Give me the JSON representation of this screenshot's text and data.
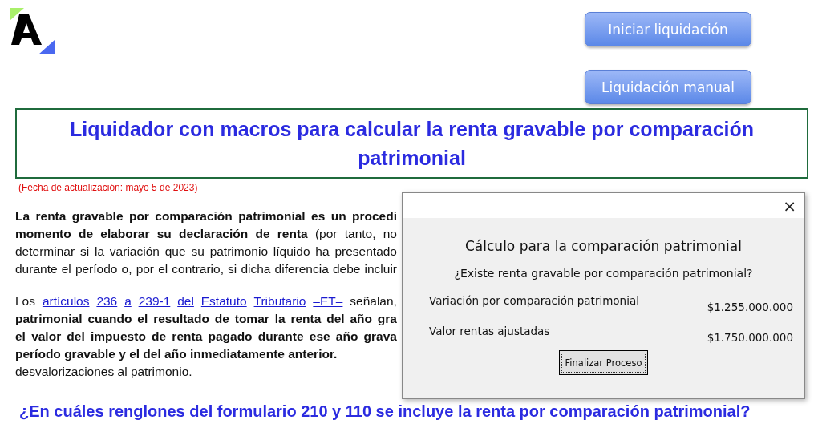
{
  "buttons": [
    "Iniciar liquidación",
    "Liquidación manual"
  ],
  "title": "Liquidador con macros para calcular la renta gravable por comparación patrimonial",
  "update_note": "(Fecha de actualización: mayo 5 de 2023)",
  "paragraphs": [
    {
      "lines": [
        {
          "bold": true,
          "justify": true,
          "segments": [
            {
              "kind": "text",
              "text": "La renta gravable por comparación patrimonial es un procedi"
            }
          ]
        },
        {
          "bold": false,
          "justify": true,
          "segments": [
            {
              "kind": "text",
              "text": "**momento de elaborar su declaración de renta** (por tanto, no"
            }
          ]
        },
        {
          "bold": false,
          "justify": true,
          "segments": [
            {
              "kind": "text",
              "text": "determinar si la variación que su patrimonio líquido ha presentado"
            }
          ]
        },
        {
          "bold": false,
          "justify": true,
          "segments": [
            {
              "kind": "text",
              "text": "durante el período o, por el contrario, si dicha diferencia debe incluir"
            }
          ]
        }
      ]
    },
    {
      "lines": [
        {
          "bold": false,
          "justify": true,
          "segments": [
            {
              "kind": "text",
              "text": "Los"
            },
            {
              "kind": "link",
              "text": "artículos"
            },
            {
              "kind": "link",
              "text": "236"
            },
            {
              "kind": "link",
              "text": "a"
            },
            {
              "kind": "link",
              "text": "239-1"
            },
            {
              "kind": "link",
              "text": "del"
            },
            {
              "kind": "link",
              "text": "Estatuto"
            },
            {
              "kind": "link",
              "text": "Tributario"
            },
            {
              "kind": "link",
              "text": "–ET–"
            },
            {
              "kind": "text",
              "text": "señalan,"
            }
          ]
        },
        {
          "bold": true,
          "justify": true,
          "segments": [
            {
              "kind": "text",
              "text": "patrimonial cuando el resultado de tomar la renta del año gra"
            }
          ]
        },
        {
          "bold": true,
          "justify": true,
          "segments": [
            {
              "kind": "text",
              "text": "el valor del impuesto de renta pagado durante ese año grava"
            }
          ]
        },
        {
          "bold": true,
          "justify": false,
          "segments": [
            {
              "kind": "text",
              "text": "período gravable y el del año inmediatamente anterior."
            }
          ]
        },
        {
          "bold": false,
          "justify": false,
          "segments": [
            {
              "kind": "text",
              "text": "desvalorizaciones al patrimonio."
            }
          ]
        }
      ]
    }
  ],
  "heading": "¿En cuáles renglones del formulario 210 y 110 se incluye la renta por comparación patrimonial?",
  "dialog": {
    "close": "×",
    "title": "Cálculo para la comparación patrimonial",
    "question": "¿Existe renta gravable por comparación patrimonial?",
    "rows": [
      {
        "label": "Variación por comparación patrimonial",
        "value": "$1.255.000.000"
      },
      {
        "label": "Valor rentas ajustadas",
        "value": "$1.750.000.000"
      }
    ],
    "button": "Finalizar Proceso"
  }
}
